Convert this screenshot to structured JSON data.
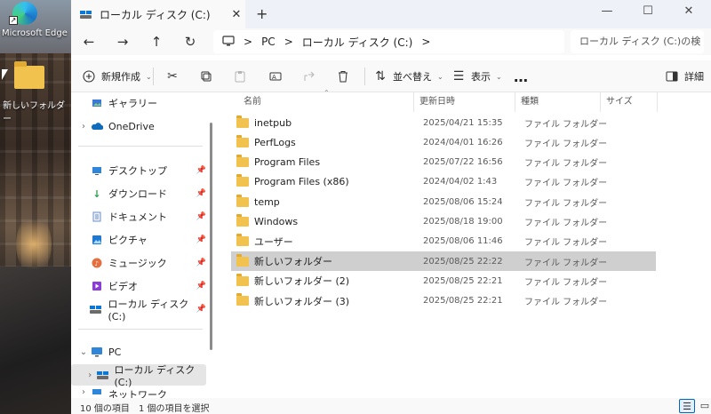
{
  "desktop": {
    "edge_label": "Microsoft Edge",
    "folder_label": "新しいフォルダー"
  },
  "window": {
    "tab_title": "ローカル ディスク (C:)",
    "tab_close": "✕",
    "new_tab": "+",
    "min": "—",
    "max": "☐",
    "close": "✕"
  },
  "nav": {
    "back": "←",
    "forward": "→",
    "up": "↑",
    "refresh": "↻"
  },
  "address": {
    "crumbs": [
      "PC",
      "ローカル ディスク (C:)"
    ],
    "sep": ">",
    "search_placeholder": "ローカル ディスク (C:)の検"
  },
  "toolbar": {
    "new_label": "新規作成",
    "sort_label": "並べ替え",
    "view_label": "表示",
    "more": "…",
    "details_label": "詳細"
  },
  "sidebar": {
    "gallery": "ギャラリー",
    "onedrive": "OneDrive",
    "quick": [
      {
        "label": "デスクトップ"
      },
      {
        "label": "ダウンロード"
      },
      {
        "label": "ドキュメント"
      },
      {
        "label": "ピクチャ"
      },
      {
        "label": "ミュージック"
      },
      {
        "label": "ビデオ"
      },
      {
        "label": "ローカル ディスク (C:)"
      }
    ],
    "pc": "PC",
    "local_disk": "ローカル ディスク (C:)",
    "network": "ネットワーク"
  },
  "columns": {
    "name": "名前",
    "date": "更新日時",
    "type": "種類",
    "size": "サイズ"
  },
  "files": [
    {
      "name": "inetpub",
      "date": "2025/04/21 15:35",
      "type": "ファイル フォルダー"
    },
    {
      "name": "PerfLogs",
      "date": "2024/04/01 16:26",
      "type": "ファイル フォルダー"
    },
    {
      "name": "Program Files",
      "date": "2025/07/22 16:56",
      "type": "ファイル フォルダー"
    },
    {
      "name": "Program Files (x86)",
      "date": "2024/04/02 1:43",
      "type": "ファイル フォルダー"
    },
    {
      "name": "temp",
      "date": "2025/08/06 15:24",
      "type": "ファイル フォルダー"
    },
    {
      "name": "Windows",
      "date": "2025/08/18 19:00",
      "type": "ファイル フォルダー"
    },
    {
      "name": "ユーザー",
      "date": "2025/08/06 11:46",
      "type": "ファイル フォルダー"
    },
    {
      "name": "新しいフォルダー",
      "date": "2025/08/25 22:22",
      "type": "ファイル フォルダー"
    },
    {
      "name": "新しいフォルダー (2)",
      "date": "2025/08/25 22:21",
      "type": "ファイル フォルダー"
    },
    {
      "name": "新しいフォルダー (3)",
      "date": "2025/08/25 22:21",
      "type": "ファイル フォルダー"
    }
  ],
  "status": {
    "count": "10 個の項目",
    "selected": "1 個の項目を選択"
  }
}
